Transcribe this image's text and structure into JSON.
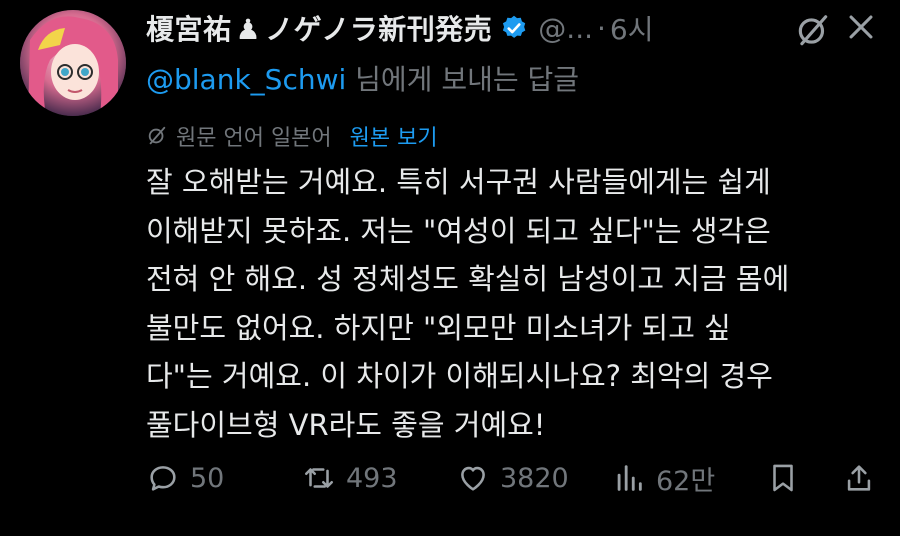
{
  "header": {
    "display_name": "榎宮祐",
    "pawn": "♟",
    "display_name_suffix": "ノゲノラ新刊発売",
    "handle": "@...",
    "separator": "·",
    "time": "6시"
  },
  "reply": {
    "mention": "@blank_Schwi",
    "text": " 님에게 보내는 답글"
  },
  "translation": {
    "label": "원문 언어 일본어",
    "view_original": "원본 보기"
  },
  "post": {
    "lines": [
      "잘 오해받는 거예요. 특히 서구권 사람들에게는 쉽게",
      "이해받지 못하죠. 저는 \"여성이 되고 싶다\"는 생각은",
      "전혀 안 해요. 성 정체성도 확실히 남성이고 지금 몸에",
      "불만도 없어요. 하지만 \"외모만 미소녀가 되고 싶",
      "다\"는 거예요. 이 차이가 이해되시나요? 최악의 경우",
      "풀다이브형 VR라도 좋을 거예요!"
    ]
  },
  "actions": {
    "replies": "50",
    "reposts": "493",
    "likes": "3820",
    "views": "62만"
  },
  "colors": {
    "background": "#000000",
    "text": "#e7e9ea",
    "muted": "#71767b",
    "accent": "#1d9bf0"
  },
  "icons": [
    "avatar",
    "pawn-icon",
    "verified-icon",
    "grok-icon",
    "more-icon",
    "translate-icon",
    "reply-icon",
    "repost-icon",
    "like-icon",
    "views-icon",
    "bookmark-icon",
    "share-icon"
  ]
}
